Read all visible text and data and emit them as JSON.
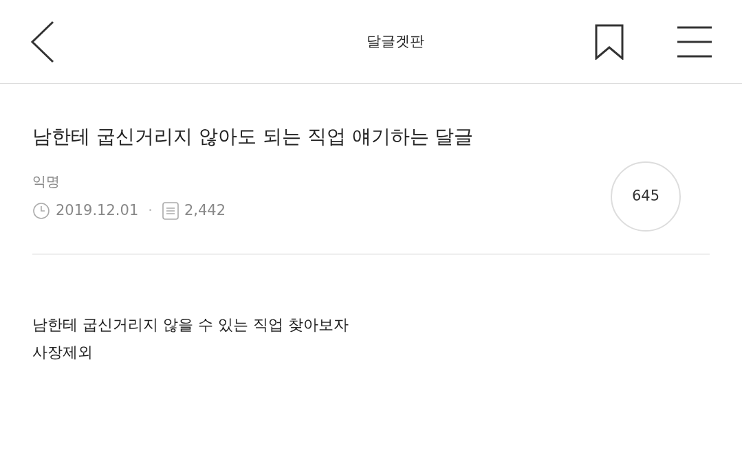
{
  "header": {
    "title": "달글겟판"
  },
  "post": {
    "title": "남한테 굽신거리지 않아도 되는 직업 얘기하는 달글",
    "author": "익명",
    "date": "2019.12.01",
    "separator": "·",
    "views": "2,442",
    "comment_count": "645"
  },
  "body": [
    "남한테 굽신거리지 않을 수 있는 직업 찾아보자",
    "사장제외"
  ]
}
